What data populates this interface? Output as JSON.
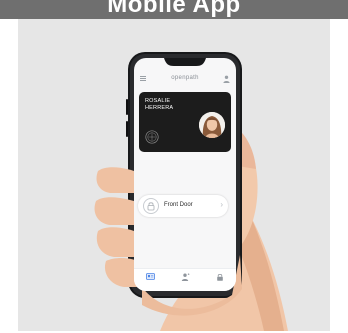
{
  "banner": {
    "text": "Mobile App"
  },
  "app": {
    "brand": "openpath",
    "card": {
      "name_line1": "ROSALIE",
      "name_line2": "HERRERA"
    },
    "door": {
      "label": "Front Door"
    },
    "nav": [
      {
        "label": "",
        "icon": "badge-icon",
        "active": true
      },
      {
        "label": "",
        "icon": "person-icon",
        "active": false
      },
      {
        "label": "",
        "icon": "lock-icon",
        "active": false
      }
    ]
  }
}
